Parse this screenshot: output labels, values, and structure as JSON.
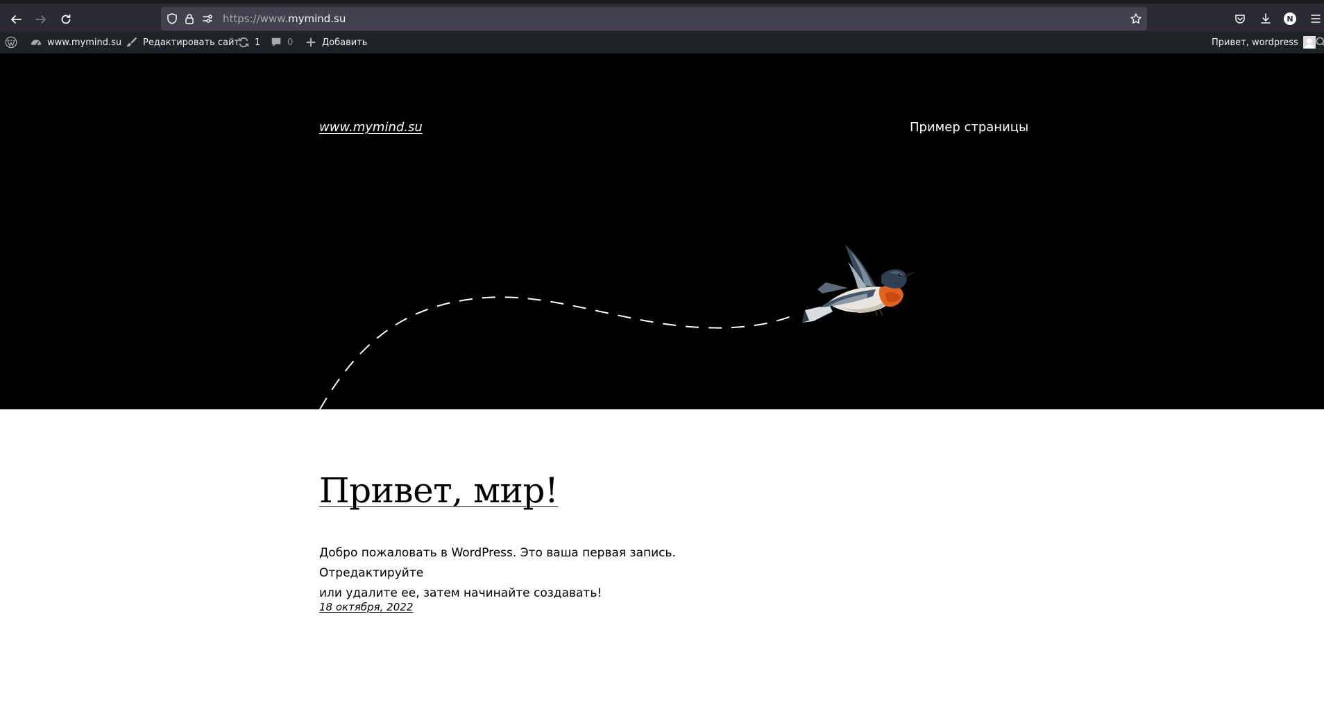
{
  "browser": {
    "url_scheme": "https://www.",
    "url_host": "mymind.su",
    "account_initial": "N"
  },
  "admin_bar": {
    "site_name": "www.mymind.su",
    "edit_site": "Редактировать сайт",
    "updates_count": "1",
    "comments_count": "0",
    "add_new": "Добавить",
    "greeting": "Привет, wordpress"
  },
  "site": {
    "title": "www.mymind.su",
    "nav": [
      "Пример страницы"
    ]
  },
  "post": {
    "title": "Привет, мир!",
    "excerpt_line1": "Добро пожаловать в WordPress. Это ваша первая запись. Отредактируйте",
    "excerpt_line2": "или удалите ее, затем начинайте создавать!",
    "date": "18 октября, 2022"
  }
}
